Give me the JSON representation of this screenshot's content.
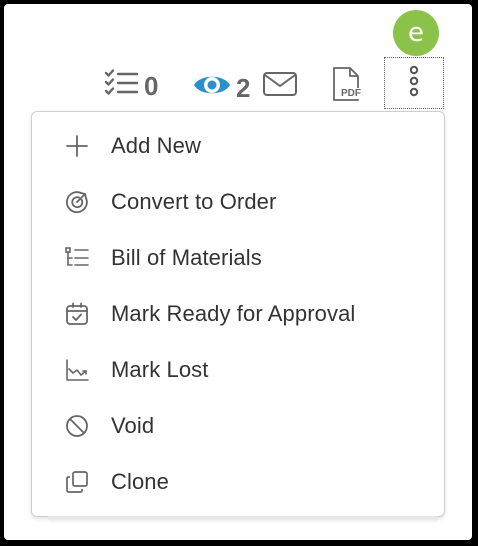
{
  "avatar": {
    "initial": "e",
    "color": "#8bc34a"
  },
  "toolbar": {
    "tasks_count": "0",
    "watchers_count": "2",
    "pdf_label": "PDF"
  },
  "colors": {
    "icon_gray": "#666666",
    "eye_blue": "#2a90c9",
    "menu_text": "#333333"
  },
  "menu": {
    "items": [
      {
        "label": "Add New",
        "icon": "plus-icon"
      },
      {
        "label": "Convert to Order",
        "icon": "convert-target-icon"
      },
      {
        "label": "Bill of Materials",
        "icon": "tree-list-icon"
      },
      {
        "label": "Mark Ready for Approval",
        "icon": "calendar-check-icon"
      },
      {
        "label": "Mark Lost",
        "icon": "chart-down-icon"
      },
      {
        "label": "Void",
        "icon": "ban-icon"
      },
      {
        "label": "Clone",
        "icon": "clone-icon"
      }
    ]
  }
}
